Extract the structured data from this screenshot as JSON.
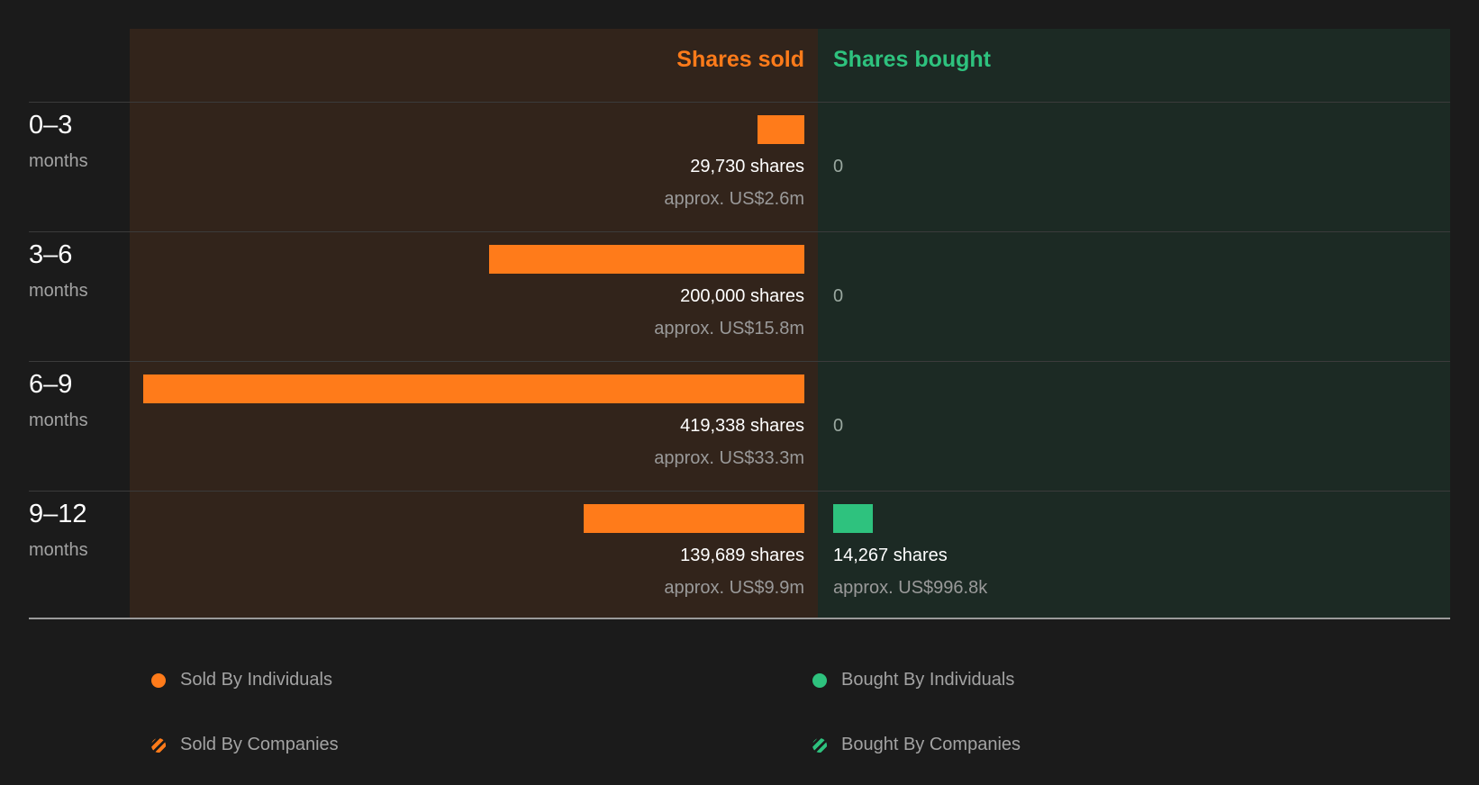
{
  "headers": {
    "sold": "Shares sold",
    "bought": "Shares bought"
  },
  "colors": {
    "sold": "#ff7b1a",
    "bought": "#2ec27e"
  },
  "chart_data": {
    "type": "bar",
    "categories": [
      "0-3 months",
      "3-6 months",
      "6-9 months",
      "9-12 months"
    ],
    "series": [
      {
        "name": "Shares sold",
        "values": [
          29730,
          200000,
          419338,
          139689
        ]
      },
      {
        "name": "Shares bought",
        "values": [
          0,
          0,
          0,
          14267
        ]
      }
    ],
    "max_value": 419338,
    "rows": [
      {
        "range": "0–3",
        "unit": "months",
        "sold": 29730,
        "sold_text": "29,730 shares",
        "sold_approx": "approx. US$2.6m",
        "bought": 0,
        "bought_text": "0",
        "bought_approx": ""
      },
      {
        "range": "3–6",
        "unit": "months",
        "sold": 200000,
        "sold_text": "200,000 shares",
        "sold_approx": "approx. US$15.8m",
        "bought": 0,
        "bought_text": "0",
        "bought_approx": ""
      },
      {
        "range": "6–9",
        "unit": "months",
        "sold": 419338,
        "sold_text": "419,338 shares",
        "sold_approx": "approx. US$33.3m",
        "bought": 0,
        "bought_text": "0",
        "bought_approx": ""
      },
      {
        "range": "9–12",
        "unit": "months",
        "sold": 139689,
        "sold_text": "139,689 shares",
        "sold_approx": "approx. US$9.9m",
        "bought": 14267,
        "bought_text": "14,267 shares",
        "bought_approx": "approx. US$996.8k"
      }
    ]
  },
  "legend": [
    {
      "label": "Sold By Individuals",
      "style": "solid-orange"
    },
    {
      "label": "Bought By Individuals",
      "style": "solid-green"
    },
    {
      "label": "Sold By Companies",
      "style": "striped-orange"
    },
    {
      "label": "Bought By Companies",
      "style": "striped-green"
    }
  ]
}
